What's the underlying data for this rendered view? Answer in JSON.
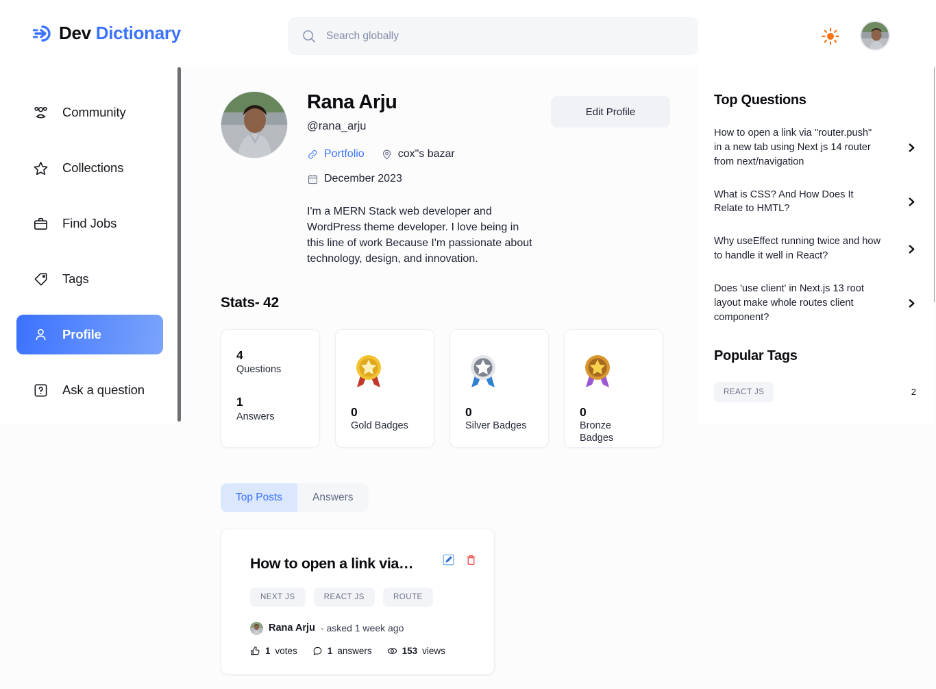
{
  "header": {
    "logo_text_primary": "Dev",
    "logo_text_accent": "Dictionary",
    "logo_icon": "arrow-into-circle-icon",
    "search_placeholder": "Search globally",
    "search_value": "",
    "search_icon": "search-icon",
    "theme_icon": "sun-icon",
    "avatar": "user-avatar"
  },
  "sidebar": {
    "items": [
      {
        "label": "Community",
        "icon": "users-icon",
        "active": false
      },
      {
        "label": "Collections",
        "icon": "star-icon",
        "active": false
      },
      {
        "label": "Find Jobs",
        "icon": "briefcase-icon",
        "active": false
      },
      {
        "label": "Tags",
        "icon": "tag-icon",
        "active": false
      },
      {
        "label": "Profile",
        "icon": "user-icon",
        "active": true
      },
      {
        "label": "Ask a question",
        "icon": "question-box-icon",
        "active": false
      }
    ]
  },
  "profile": {
    "name": "Rana Arju",
    "handle": "@rana_arju",
    "portfolio_label": "Portfolio",
    "location": "cox\"s bazar",
    "joined": "December 2023",
    "bio": "I'm a MERN Stack web developer and WordPress theme developer. I love being in this line of work Because I'm passionate about technology, design, and innovation.",
    "edit_button": "Edit Profile"
  },
  "stats": {
    "title": "Stats- 42",
    "cards": [
      {
        "type": "counts",
        "questions_value": "4",
        "questions_label": "Questions",
        "answers_value": "1",
        "answers_label": "Answers"
      },
      {
        "type": "badge",
        "medal": "gold-medal-icon",
        "value": "0",
        "label": "Gold Badges"
      },
      {
        "type": "badge",
        "medal": "silver-medal-icon",
        "value": "0",
        "label": "Silver Badges"
      },
      {
        "type": "badge",
        "medal": "bronze-medal-icon",
        "value": "0",
        "label": "Bronze Badges"
      }
    ]
  },
  "tabs": [
    {
      "label": "Top Posts",
      "active": true
    },
    {
      "label": "Answers",
      "active": false
    }
  ],
  "post": {
    "title": "How to open a link via…",
    "edit_icon": "edit-square-icon",
    "delete_icon": "trash-icon",
    "tags": [
      "NEXT JS",
      "REACT JS",
      "ROUTE"
    ],
    "author": "Rana Arju",
    "asked": "- asked 1 week ago",
    "votes_value": "1",
    "votes_label": "votes",
    "answers_value": "1",
    "answers_label": "answers",
    "views_value": "153",
    "views_label": "views"
  },
  "right_panel": {
    "top_questions_title": "Top Questions",
    "questions": [
      "How to open a link via \"router.push\" in a new tab using Next js 14 router from next/navigation",
      "What is CSS? And How Does It Relate to HMTL?",
      "Why useEffect running twice and how to handle it well in React?",
      "Does 'use client' in Next.js 13 root layout make whole routes client component?"
    ],
    "popular_tags_title": "Popular Tags",
    "tags": [
      {
        "name": "REACT JS",
        "count": "2"
      }
    ]
  },
  "colors": {
    "accent": "#3b72ff",
    "accent_light": "#7ba4fb",
    "tab_active_bg": "#dae7fd",
    "chip_bg": "#f2f4f7",
    "sun": "#f97316",
    "delete": "#f0534f",
    "page_bg": "#fcfcfd"
  }
}
